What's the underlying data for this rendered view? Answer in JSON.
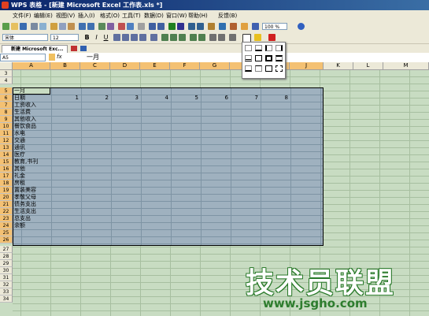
{
  "window": {
    "title": "WPS 表格 - [新建 Microsoft Excel 工作表.xls *]"
  },
  "menu": [
    "文件(F)",
    "编辑(E)",
    "视图(V)",
    "插入(I)",
    "格式(O)",
    "工具(T)",
    "数据(D)",
    "窗口(W)",
    "帮助(H)",
    "反馈(B)"
  ],
  "toolbar": {
    "font": "宋体",
    "size": "12",
    "bold": "B",
    "italic": "I",
    "underline": "U",
    "zoom": "100 %"
  },
  "tab": {
    "label": "新建 Microsoft Exc..."
  },
  "formula": {
    "cell_ref": "A5",
    "fx": "fx",
    "content": "一月"
  },
  "columns": [
    "A",
    "B",
    "C",
    "D",
    "E",
    "F",
    "G",
    "H",
    "I",
    "J",
    "K",
    "L",
    "M"
  ],
  "rows": [
    "3",
    "4",
    "5",
    "6",
    "7",
    "8",
    "9",
    "10",
    "11",
    "12",
    "13",
    "14",
    "15",
    "16",
    "17",
    "18",
    "19",
    "20",
    "21",
    "22",
    "23",
    "24",
    "25",
    "26",
    "27",
    "28",
    "29",
    "30",
    "31",
    "32",
    "33",
    "34"
  ],
  "colA": [
    "一月",
    "日期",
    "工资收入",
    "生活费",
    "其他收入",
    "餐饮食品",
    "水电",
    "交通",
    "通讯",
    "医疗",
    "教育,书刊",
    "其他",
    "礼金",
    "房租",
    "置装美容",
    "孝敬父母",
    "债务支出",
    "生活支出",
    "总支出",
    "余额"
  ],
  "days": [
    "1",
    "2",
    "3",
    "4",
    "5",
    "6",
    "7",
    "8"
  ],
  "watermark": {
    "logo": "技术员联盟",
    "url": "www.jsgho.com"
  }
}
